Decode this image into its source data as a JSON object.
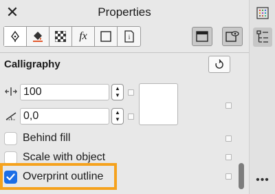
{
  "window": {
    "title": "Properties",
    "close_glyph": "✕"
  },
  "tabs": [
    {
      "name": "outline-pen-tab",
      "icon": "pen-nib-icon"
    },
    {
      "name": "fill-tab",
      "icon": "fill-bucket-icon"
    },
    {
      "name": "transparency-tab",
      "icon": "checkerboard-icon"
    },
    {
      "name": "effects-tab",
      "icon": "fx-icon",
      "glyph": "fx"
    },
    {
      "name": "frame-tab",
      "icon": "square-frame-icon"
    },
    {
      "name": "summary-tab",
      "icon": "info-page-icon",
      "glyph": "i"
    }
  ],
  "section": {
    "title": "Calligraphy"
  },
  "fields": {
    "stretch": {
      "value": "100",
      "icon": "stretch-icon"
    },
    "angle": {
      "value": "0,0",
      "icon": "angle-icon"
    }
  },
  "checkboxes": [
    {
      "label": "Behind fill",
      "checked": false
    },
    {
      "label": "Scale with object",
      "checked": false
    },
    {
      "label": "Overprint outline",
      "checked": true
    }
  ],
  "stepper_glyphs": {
    "up": "▲",
    "down": "▼"
  },
  "rail": {
    "more_label": "•••"
  },
  "colors": {
    "accent": "#1c6ee6",
    "highlight": "#f5a21d",
    "panel": "#e8e8e8"
  }
}
